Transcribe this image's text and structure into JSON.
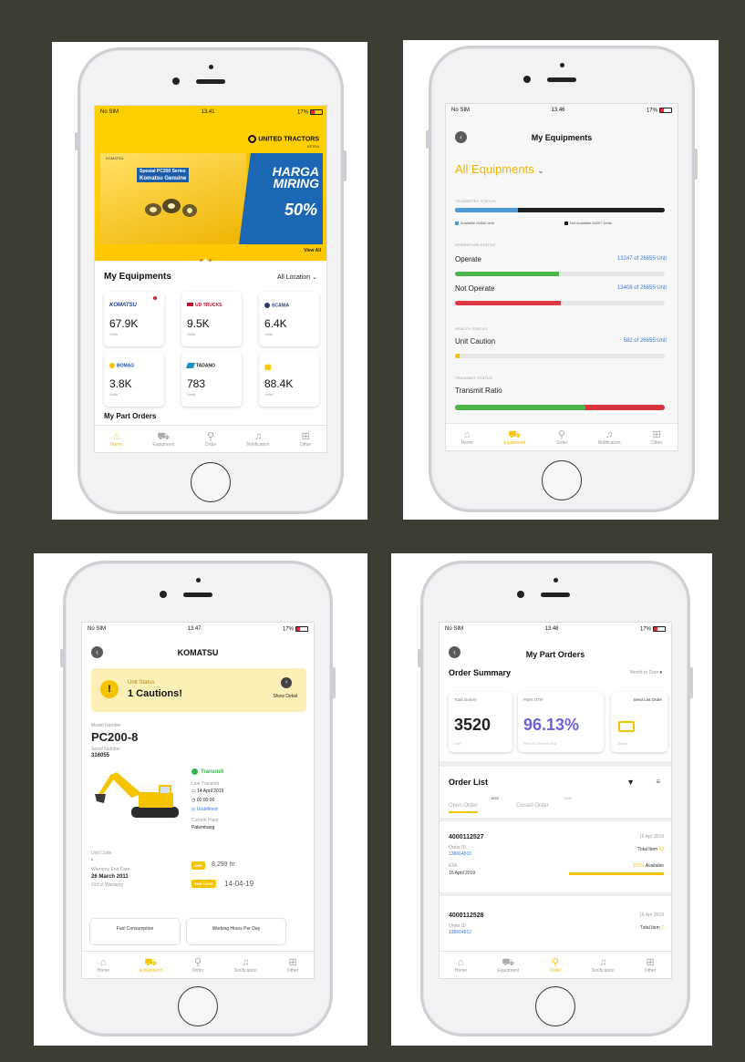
{
  "screen1": {
    "status": {
      "carrier": "No SIM",
      "time": "13.41",
      "battery": "17%"
    },
    "brand": {
      "name": "UNITED TRACTORS",
      "sub": "ASTRA"
    },
    "banner": {
      "brand": "KOMATSU",
      "tag1": "Spesial PC200 Series",
      "tag2": "Komatsu Genuine",
      "headline": "HARGA MIRING",
      "discount": "50%"
    },
    "view_all": "View All",
    "section_title": "My Equipments",
    "location": "All Location",
    "cards": [
      {
        "brand": "KOMATSU",
        "value": "67.9K",
        "unit": "Units",
        "color": "#1d3f8f"
      },
      {
        "brand": "UD TRUCKS",
        "value": "9.5K",
        "unit": "Units",
        "color": "#c8102e"
      },
      {
        "brand": "SCANIA",
        "value": "6.4K",
        "unit": "Units",
        "color": "#2a3c6b"
      },
      {
        "brand": "BOMAG",
        "value": "3.8K",
        "unit": "Units",
        "color": "#1d4f9c"
      },
      {
        "brand": "TADANO",
        "value": "783",
        "unit": "Units",
        "color": "#1a1a1a"
      },
      {
        "brand": "",
        "value": "88.4K",
        "unit": "Units",
        "color": "#f5c400"
      }
    ],
    "peek": "My Part Orders",
    "tabs": [
      "Home",
      "Equipment",
      "Order",
      "Notification",
      "Other"
    ]
  },
  "screen2": {
    "status": {
      "carrier": "No SIM",
      "time": "13.46",
      "battery": "17%"
    },
    "title": "My Equipments",
    "filter": "All Equipments",
    "telemetry_label": "TELEMETRY STATUS",
    "telemetry_available": 0.3,
    "legend_available": "Available 26830 Unit",
    "legend_not_available": "Not Available 60207 Units",
    "operation_label": "OPERATION STATUS",
    "operate": {
      "label": "Operate",
      "value": "13247 of 26655 Unit",
      "ratio": 0.497
    },
    "not_operate": {
      "label": "Not Operate",
      "value": "13408 of 26655 Unit",
      "ratio": 0.503
    },
    "health_label": "HEALTH STATUS",
    "caution": {
      "label": "Unit Caution",
      "value": "582 of 26655 Unit",
      "ratio": 0.022
    },
    "transmit_label": "TRANSMIT STATUS",
    "transmit": {
      "label": "Transmit Ratio",
      "ratio": 0.62
    },
    "tabs": [
      "Home",
      "Equipment",
      "Order",
      "Notification",
      "Other"
    ]
  },
  "screen3": {
    "status": {
      "carrier": "No SIM",
      "time": "13.47",
      "battery": "17%"
    },
    "title": "KOMATSU",
    "unit_status_label": "Unit Status",
    "unit_status": "1 Cautions!",
    "show_detail": "Show Detail",
    "model_label": "Model Number",
    "model": "PC200-8",
    "serial_label": "Serial Number",
    "serial": "316055",
    "transmit": "Transmit",
    "last_transmit_label": "Last Transmit",
    "last_date": "14 April 2019",
    "last_time": "00:00:00",
    "last_loc": "Undefined",
    "current_plant_label": "Current Plant",
    "current_plant": "Palembang",
    "unit_code_label": "Unit Code",
    "unit_code": "-",
    "warranty_label": "Warranty End Date",
    "warranty": "26 March 2011",
    "warranty_status": "Out of Warranty",
    "smr_chip": "SMR",
    "smr": "8,299 hr",
    "smr_date_chip": "SMR DATE",
    "smr_date": "14-04-19",
    "peek1": "Fuel Consumption",
    "peek2": "Working Hours Per Day",
    "tabs": [
      "Home",
      "Equipment",
      "Order",
      "Notification",
      "Other"
    ]
  },
  "screen4": {
    "status": {
      "carrier": "No SIM",
      "time": "13.48",
      "battery": "17%"
    },
    "title": "My Part Orders",
    "summary_title": "Order Summary",
    "period": "Month to Date",
    "cards": [
      {
        "label": "Total Orders",
        "value": "3520",
        "sub": "Unit"
      },
      {
        "label": "Parts OTIF",
        "value": "96.13%",
        "sub": "Part On-Time In-Full"
      }
    ],
    "send_card": {
      "label": "Send List Order",
      "sub": "Email"
    },
    "list_title": "Order List",
    "tab_open": "Open Order",
    "tab_open_count": "1922",
    "tab_closed": "Closed Order",
    "tab_closed_count": "1598",
    "orders": [
      {
        "no": "4000112527",
        "date": "16 Apr 2019",
        "id_label": "Order ID",
        "id": "138664810",
        "total_label": "Total Item",
        "total": "33",
        "eta_label": "ETA",
        "eta": "16 April 2019",
        "avail": "100%",
        "avail_label": "Available"
      },
      {
        "no": "4000112528",
        "date": "16 Apr 2019",
        "id_label": "Order ID",
        "id": "138664812",
        "total_label": "Total Item",
        "total": "7"
      }
    ],
    "tabs": [
      "Home",
      "Equipment",
      "Order",
      "Notification",
      "Other"
    ]
  },
  "colors": {
    "yellow": "#f5c400",
    "blue": "#3a7bd5",
    "green": "#37b24d",
    "red": "#e03131"
  }
}
